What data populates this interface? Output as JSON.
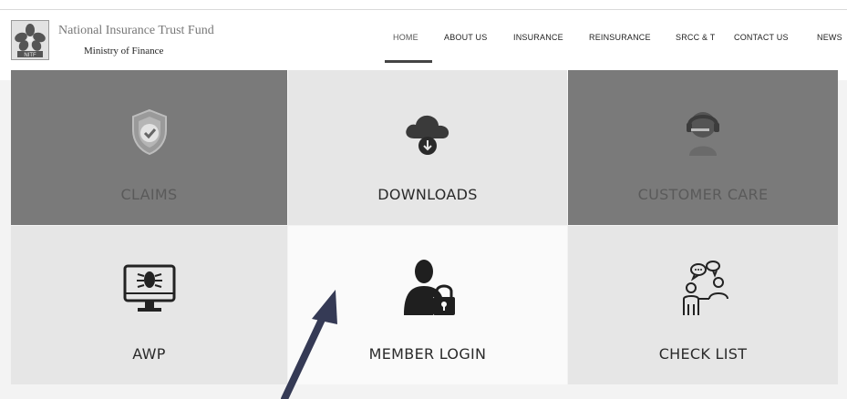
{
  "header": {
    "org_name": "National Insurance Trust Fund",
    "org_subtitle": "Ministry of Finance",
    "logo_text": "NITF"
  },
  "nav": {
    "items": [
      "HOME",
      "ABOUT US",
      "INSURANCE",
      "REINSURANCE",
      "SRCC & T",
      "CONTACT US",
      "NEWS"
    ],
    "active": "HOME"
  },
  "tiles": {
    "claims": "CLAIMS",
    "downloads": "DOWNLOADS",
    "customer_care": "CUSTOMER CARE",
    "awp": "AWP",
    "member_login": "MEMBER LOGIN",
    "check_list": "CHECK LIST"
  },
  "colors": {
    "dark_tile": "#7a7a7a",
    "light_tile": "#e6e6e6",
    "icon_dark": "#222222"
  }
}
